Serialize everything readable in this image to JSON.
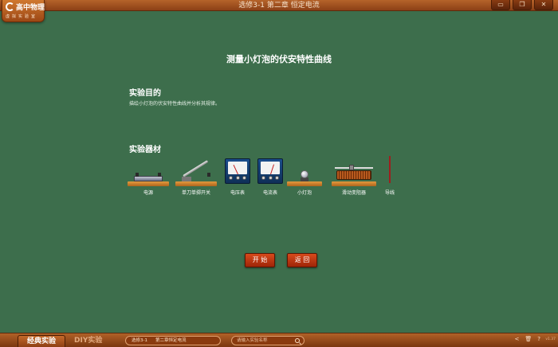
{
  "app": {
    "logo_name": "高中物理",
    "logo_sub": "虚拟实验室",
    "window_title": "选修3-1   第二章 恒定电流",
    "window_controls": {
      "minimize": "▭",
      "restore": "❐",
      "close": "✕"
    }
  },
  "experiment": {
    "title": "测量小灯泡的伏安特性曲线",
    "purpose_heading": "实验目的",
    "purpose_text": "描绘小灯泡的伏安特性曲线并分析其规律。",
    "equipment_heading": "实验器材",
    "equipment": [
      {
        "label": "电源",
        "icon": "power-supply-icon"
      },
      {
        "label": "单刀单掷开关",
        "icon": "knife-switch-icon"
      },
      {
        "label": "电压表",
        "icon": "voltmeter-icon"
      },
      {
        "label": "电流表",
        "icon": "ammeter-icon"
      },
      {
        "label": "小灯泡",
        "icon": "bulb-icon"
      },
      {
        "label": "滑动变阻器",
        "icon": "rheostat-icon"
      },
      {
        "label": "导线",
        "icon": "wire-icon"
      }
    ]
  },
  "actions": {
    "start": "开 始",
    "back": "返 回"
  },
  "bottombar": {
    "tab_classic": "经典实验",
    "tab_diy": "DIY实验",
    "breadcrumb": [
      "选修3-1",
      "第二章恒定电流"
    ],
    "search_placeholder": "请输入实验名称",
    "icons": {
      "share": "<",
      "delete": "🗑",
      "help": "?"
    },
    "version": "v1.37"
  },
  "colors": {
    "board_green": "#3d6e4c",
    "bar_brown": "#8c4016",
    "button_red": "#c23a12"
  }
}
